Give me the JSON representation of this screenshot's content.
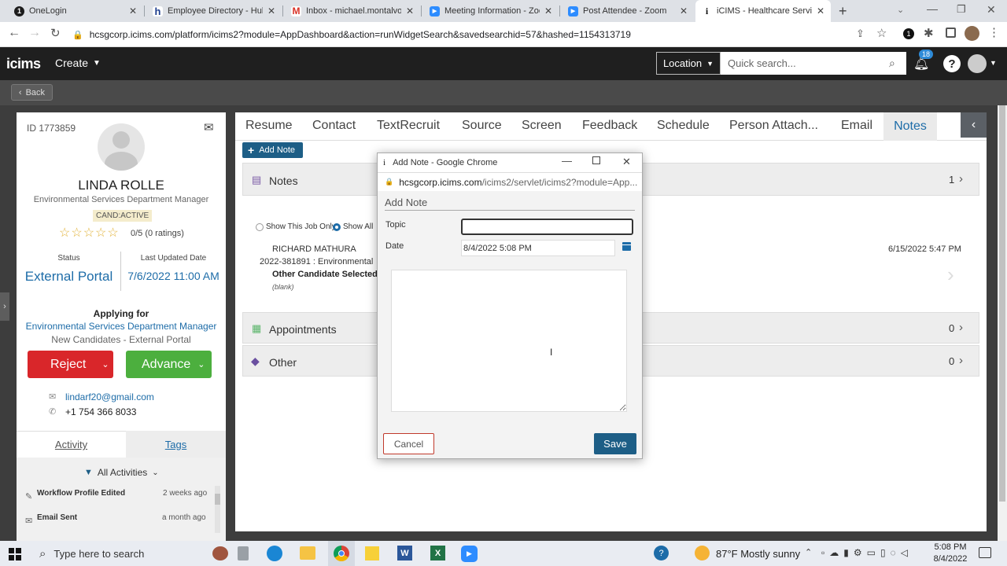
{
  "browser": {
    "tabs": [
      {
        "title": "OneLogin",
        "icon": "onelogin-icon",
        "color": "#1c1c1c",
        "glyph": "1"
      },
      {
        "title": "Employee Directory - Hub",
        "icon": "hub-icon",
        "color": "#1f3f8f",
        "glyph": "h"
      },
      {
        "title": "Inbox - michael.montalvo@",
        "icon": "gmail-icon",
        "color": "#d93025",
        "glyph": "M"
      },
      {
        "title": "Meeting Information - Zoo",
        "icon": "zoom-icon",
        "color": "#2d8cff",
        "glyph": "▶"
      },
      {
        "title": "Post Attendee - Zoom",
        "icon": "zoom-icon",
        "color": "#2d8cff",
        "glyph": "▶"
      },
      {
        "title": "iCIMS - Healthcare Services",
        "icon": "icims-icon",
        "color": "#ffffff",
        "glyph": "i"
      }
    ],
    "url": "hcsgcorp.icims.com/platform/icims2?module=AppDashboard&action=runWidgetSearch&savedsearchid=57&hashed=1154313719"
  },
  "header": {
    "logo": "icims",
    "create_label": "Create",
    "location_label": "Location",
    "search_placeholder": "Quick search...",
    "notification_count": "18"
  },
  "back_label": "Back",
  "candidate": {
    "id": "ID 1773859",
    "name": "LINDA ROLLE",
    "title": "Environmental Services Department Manager",
    "badge": "CAND:ACTIVE",
    "ratings": "0/5 (0 ratings)",
    "stars": 0,
    "status_label": "Status",
    "status_value": "External Portal",
    "updated_label": "Last Updated Date",
    "updated_value": "7/6/2022 11:00 AM",
    "applying_label": "Applying for",
    "applying_job": "Environmental Services Department Manager",
    "applying_stage": "New Candidates - External Portal",
    "reject_label": "Reject",
    "advance_label": "Advance",
    "email": "lindarf20@gmail.com",
    "phone": "+1 754 366 8033"
  },
  "activity": {
    "tab_activity": "Activity",
    "tab_tags": "Tags",
    "filter": "All Activities",
    "items": [
      {
        "label": "Workflow Profile Edited",
        "time": "2 weeks ago"
      },
      {
        "label": "Email Sent",
        "time": "a month ago"
      }
    ]
  },
  "profile_tabs": [
    "Resume",
    "Contact",
    "TextRecruit",
    "Source",
    "Screen",
    "Feedback",
    "Schedule",
    "Person Attach...",
    "Email",
    "Notes"
  ],
  "add_note_label": "Add Note",
  "notes_section": {
    "title": "Notes",
    "count": "1",
    "radio_job": "Show This Job Only",
    "radio_all": "Show All",
    "note_author": "RICHARD MATHURA",
    "note_job": "2022-381891 : Environmental",
    "note_subject": "Other Candidate Selected",
    "note_body": "(blank)",
    "note_date": "6/15/2022 5:47 PM"
  },
  "appointments_section": {
    "title": "Appointments",
    "count": "0"
  },
  "other_section": {
    "title": "Other",
    "count": "0"
  },
  "modal": {
    "window_title": "Add Note - Google Chrome",
    "url_host": "hcsgcorp.icims.com",
    "url_path": "/icims2/servlet/icims2?module=App...",
    "heading": "Add Note",
    "topic_label": "Topic",
    "topic_value": "",
    "date_label": "Date",
    "date_value": "8/4/2022 5:08 PM",
    "cancel_label": "Cancel",
    "save_label": "Save"
  },
  "taskbar": {
    "search_placeholder": "Type here to search",
    "weather": "87°F  Mostly sunny",
    "time": "5:08 PM",
    "date": "8/4/2022"
  },
  "colors": {
    "reject": "#d9262a",
    "advance": "#4caf3e",
    "accent": "#1d5e86",
    "link": "#1d6ca8"
  }
}
